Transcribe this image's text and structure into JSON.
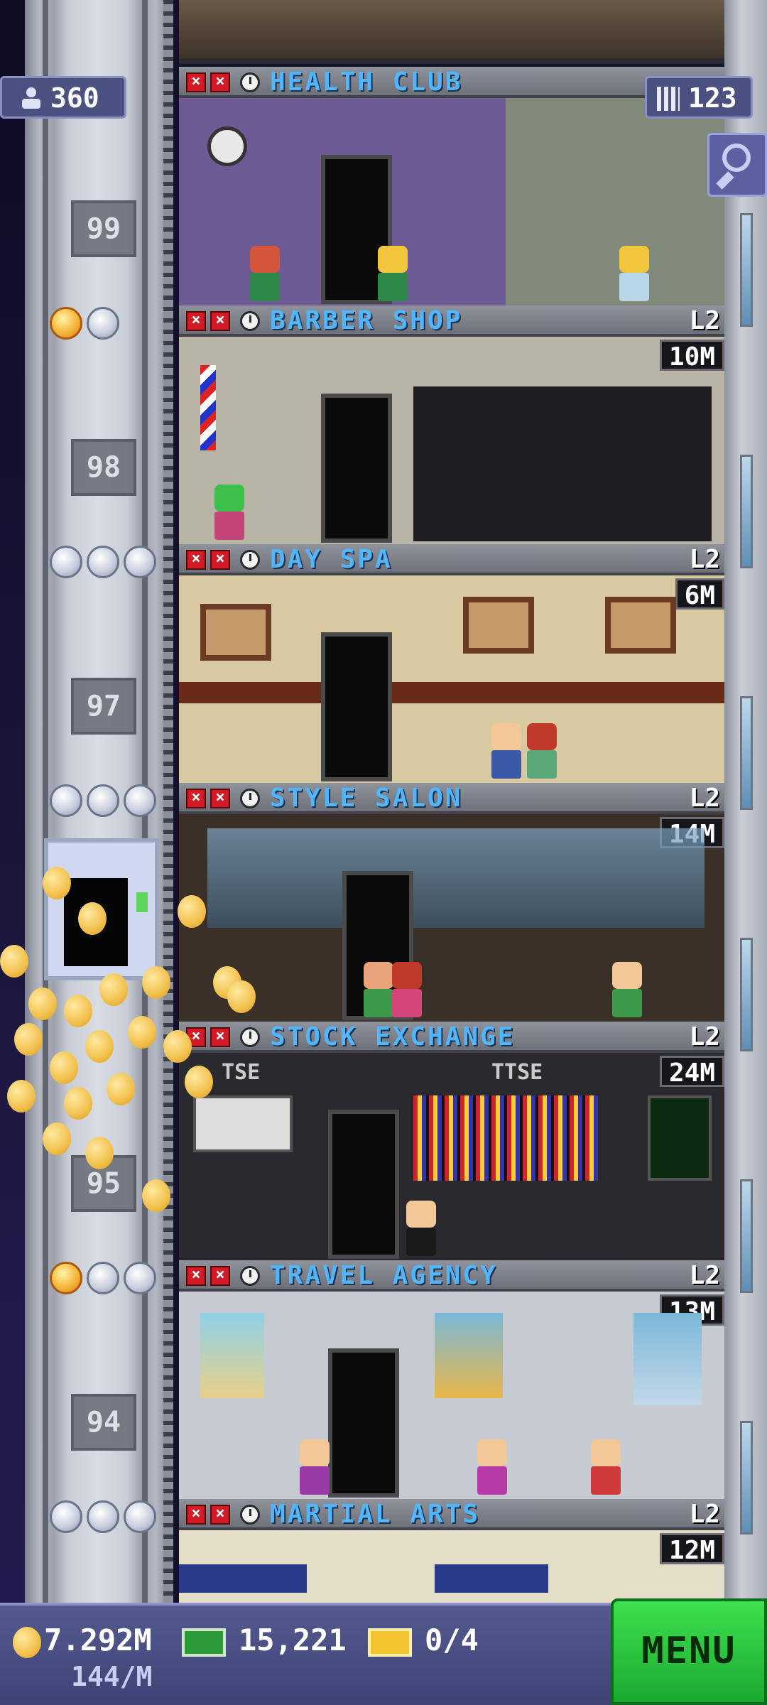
{
  "hud": {
    "population": "360",
    "floor_count": "123",
    "coins": "7.292M",
    "coins_rate": "144/M",
    "bux": "15,221",
    "tickets": "0/4",
    "menu_label": "MENU"
  },
  "floors": [
    {
      "number": "",
      "name": "HEALTH CLUB",
      "level": "",
      "income": ""
    },
    {
      "number": "99",
      "name": "BARBER SHOP",
      "level": "L2",
      "income": "10M"
    },
    {
      "number": "98",
      "name": "DAY SPA",
      "level": "L2",
      "income": "6M"
    },
    {
      "number": "97",
      "name": "STYLE SALON",
      "level": "L2",
      "income": "14M"
    },
    {
      "number": "",
      "name": "STOCK EXCHANGE",
      "level": "L2",
      "income": "24M"
    },
    {
      "number": "95",
      "name": "TRAVEL AGENCY",
      "level": "L2",
      "income": "13M"
    },
    {
      "number": "94",
      "name": "MARTIAL ARTS",
      "level": "L2",
      "income": "12M"
    }
  ],
  "signs": {
    "tse_left": "TSE",
    "tse_right": "TTSE"
  },
  "colors": {
    "floor_name": "#4fb6ff",
    "menu": "#2ecf40",
    "hud_bar": "#4b5180"
  }
}
